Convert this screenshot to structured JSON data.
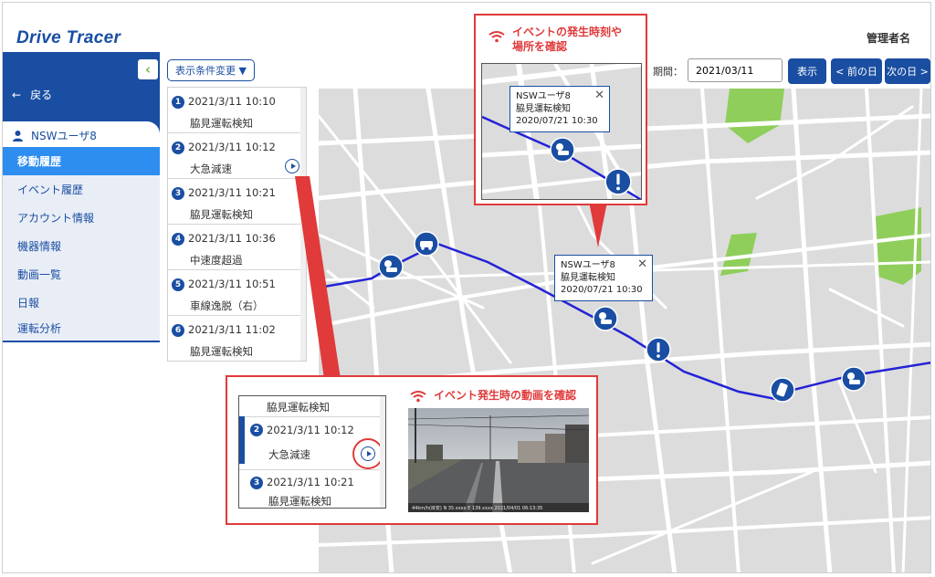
{
  "header": {
    "logo": "Drive Tracer",
    "admin": "管理者名"
  },
  "sidebar": {
    "collapse": "‹",
    "back": "戻る",
    "user": "NSWユーザ8",
    "items": [
      {
        "label": "移動履歴"
      },
      {
        "label": "イベント履歴"
      },
      {
        "label": "アカウント情報"
      },
      {
        "label": "機器情報"
      },
      {
        "label": "動画一覧"
      },
      {
        "label": "日報"
      },
      {
        "label": "運転分析"
      }
    ]
  },
  "toolbar": {
    "filter": "表示条件変更 ▼",
    "period_label": "期間：",
    "date": "2021/03/11",
    "show": "表示",
    "prev": "< 前の日",
    "next": "次の日 >"
  },
  "events": [
    {
      "num": "1",
      "datetime": "2021/3/11 10:10",
      "name": "脇見運転検知"
    },
    {
      "num": "2",
      "datetime": "2021/3/11 10:12",
      "name": "大急減速"
    },
    {
      "num": "3",
      "datetime": "2021/3/11 10:21",
      "name": "脇見運転検知"
    },
    {
      "num": "4",
      "datetime": "2021/3/11 10:36",
      "name": "中速度超過"
    },
    {
      "num": "5",
      "datetime": "2021/3/11 10:51",
      "name": "車線逸脱（右）"
    },
    {
      "num": "6",
      "datetime": "2021/3/11 11:02",
      "name": "脇見運転検知"
    }
  ],
  "map_popup": {
    "user": "NSWユーザ8",
    "event": "脇見運転検知",
    "time": "2020/07/21 10:30"
  },
  "callout_top": {
    "title1": "イベントの発生時刻や",
    "title2": "場所を確認"
  },
  "callout_bottom": {
    "title": "イベント発生時の動画を確認",
    "video_caption": "44km/h(目安)  N 35.xxxx  E 139.xxxx         2021/04/01 06:13:35"
  },
  "colors": {
    "brand": "#1a4ea2",
    "accent": "#2d8ef0",
    "callout": "#e03a3a",
    "park": "#8fce5a"
  }
}
